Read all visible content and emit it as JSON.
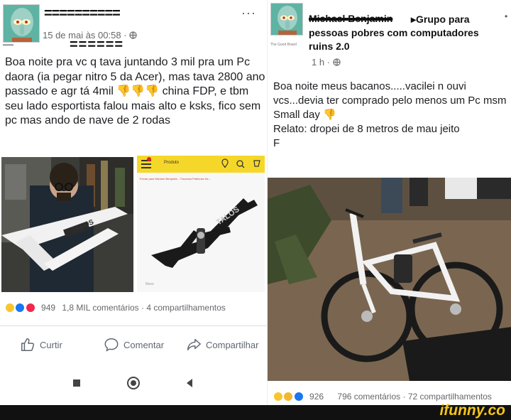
{
  "left_post": {
    "author": "==========",
    "timestamp": "15 de mai às 00:58 · ",
    "more_label": "···",
    "page_tag": "▬▬▬",
    "name_strike": "======",
    "body": "Boa noite pra vc q tava juntando 3 mil pra um Pc daora (ia pegar nitro 5 da Acer), mas tava 2800 ano passado e agr tá 4mil 👎👎👎 china FDP, e tbm  seu lado esportista falou mais alto e ksks, fico sem pc mas ando de nave de 2 rodas",
    "store_screen": {
      "header_label": "Produto",
      "address": "Enviar para Michael Benjamin - Travessa Particular 5a..."
    },
    "reactions": {
      "count": "949",
      "comments": "1,8 MIL comentários",
      "shares": "4 compartilhamentos"
    },
    "actions": {
      "like": "Curtir",
      "comment": "Comentar",
      "share": "Compartilhar"
    },
    "colors": {
      "store_yellow": "#f5d72a",
      "frame_white": "#f3f3f3",
      "frame_black": "#1a1a1a"
    }
  },
  "right_post": {
    "author": "Michael Benjamin",
    "group": "Grupo para pessoas pobres com computadores ruins 2.0",
    "page_tag": "The Good Board",
    "timestamp": "1 h · ",
    "body": "Boa noite meus bacanos.....vacilei n ouvi vcs...devia ter comprado pelo menos um Pc msm\nSmall day 👎\nRelato: dropei de 8 metros de mau jeito\nF",
    "dot_label": "•",
    "reactions": {
      "count": "926",
      "comments": "796 comentários",
      "shares": "72 compartilhamentos"
    }
  },
  "footer": {
    "logo": "ifunny.co"
  }
}
